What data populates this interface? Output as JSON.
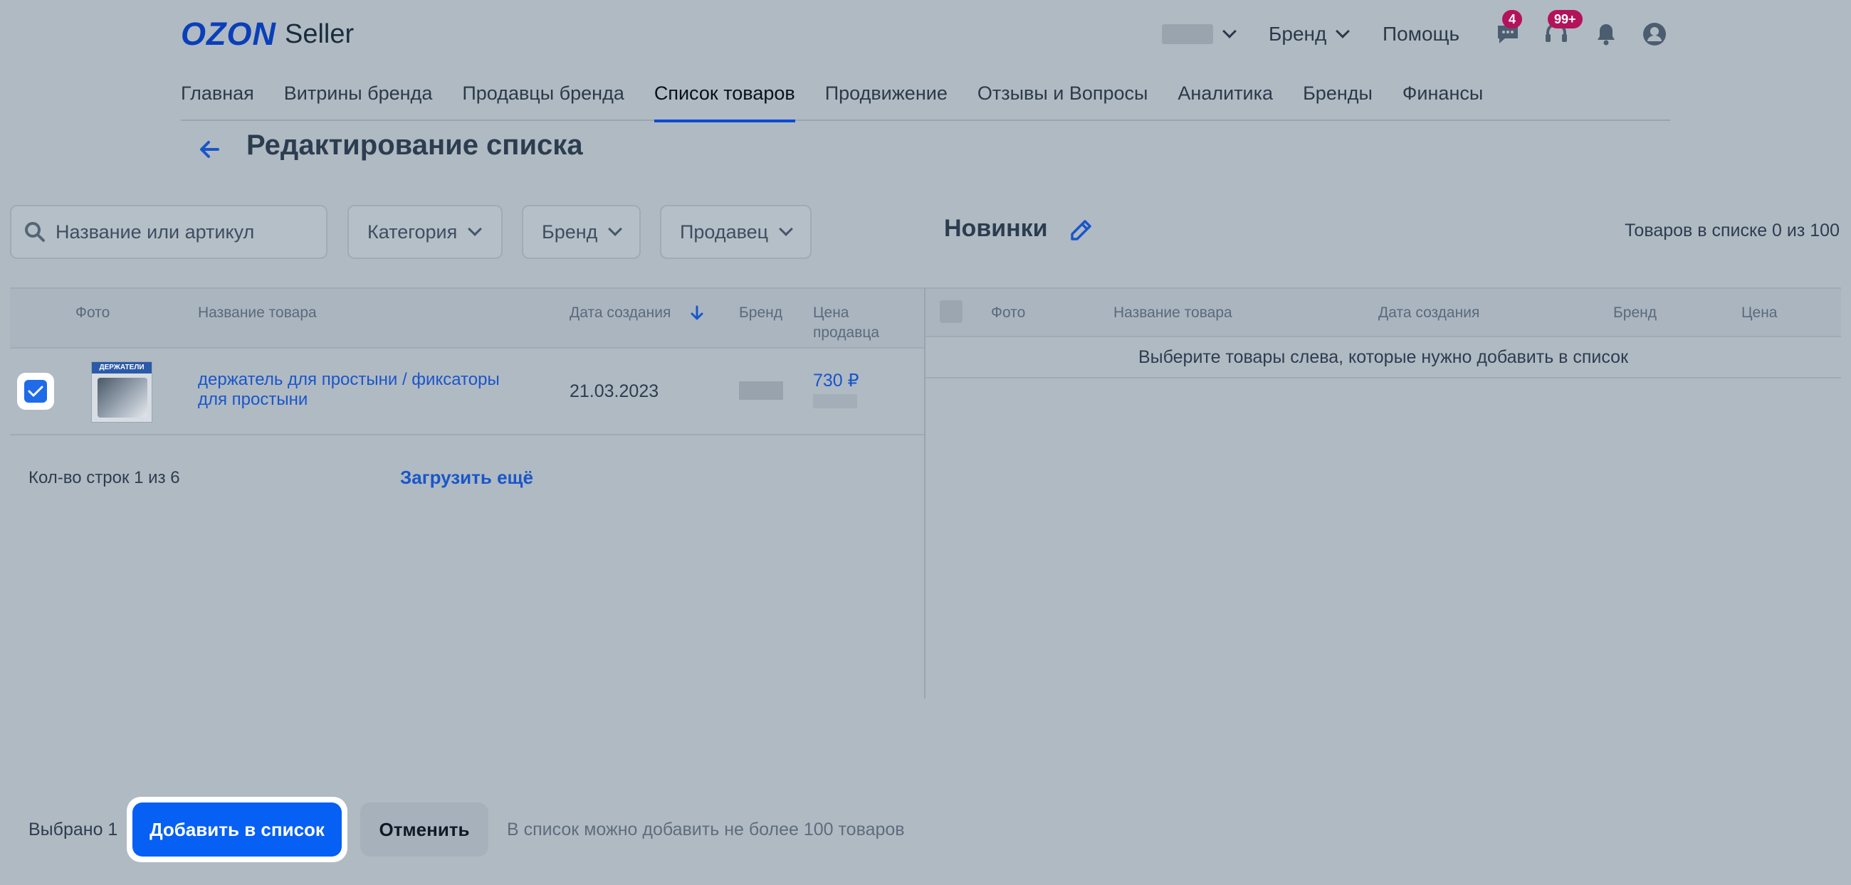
{
  "header": {
    "logo_ozon": "OZON",
    "logo_seller": "Seller",
    "brand_selector": "Бренд",
    "help": "Помощь",
    "chat_badge": "4",
    "support_badge": "99+"
  },
  "nav": {
    "items": [
      "Главная",
      "Витрины бренда",
      "Продавцы бренда",
      "Список товаров",
      "Продвижение",
      "Отзывы и Вопросы",
      "Аналитика",
      "Бренды",
      "Финансы"
    ],
    "active": "Список товаров"
  },
  "page": {
    "title": "Редактирование списка"
  },
  "filters": {
    "search_placeholder": "Название или артикул",
    "category": "Категория",
    "brand": "Бренд",
    "seller": "Продавец"
  },
  "list": {
    "name": "Новинки",
    "count_info": "Товаров в списке 0 из 100"
  },
  "left_table": {
    "headers": {
      "photo": "Фото",
      "name": "Название товара",
      "date": "Дата создания",
      "brand": "Бренд",
      "price_line1": "Цена",
      "price_line2": "продавца"
    },
    "rows": [
      {
        "checked": true,
        "thumb_label": "ДЕРЖАТЕЛИ",
        "name": "держатель для простыни / фиксаторы для простыни",
        "date": "21.03.2023",
        "price": "730 ₽"
      }
    ],
    "rows_count": "Кол-во строк 1 из 6",
    "load_more": "Загрузить ещё"
  },
  "right_table": {
    "headers": {
      "photo": "Фото",
      "name": "Название товара",
      "date": "Дата создания",
      "brand": "Бренд",
      "price": "Цена"
    },
    "empty_message": "Выберите товары слева, которые нужно добавить в список"
  },
  "footer": {
    "selected": "Выбрано 1",
    "add_button": "Добавить в список",
    "cancel_button": "Отменить",
    "limit_note": "В список можно добавить не более 100 товаров"
  },
  "colors": {
    "accent": "#0760F4",
    "link": "#1A56C9",
    "badge": "#B3135B",
    "overlay_bg": "#B0BAC3"
  }
}
